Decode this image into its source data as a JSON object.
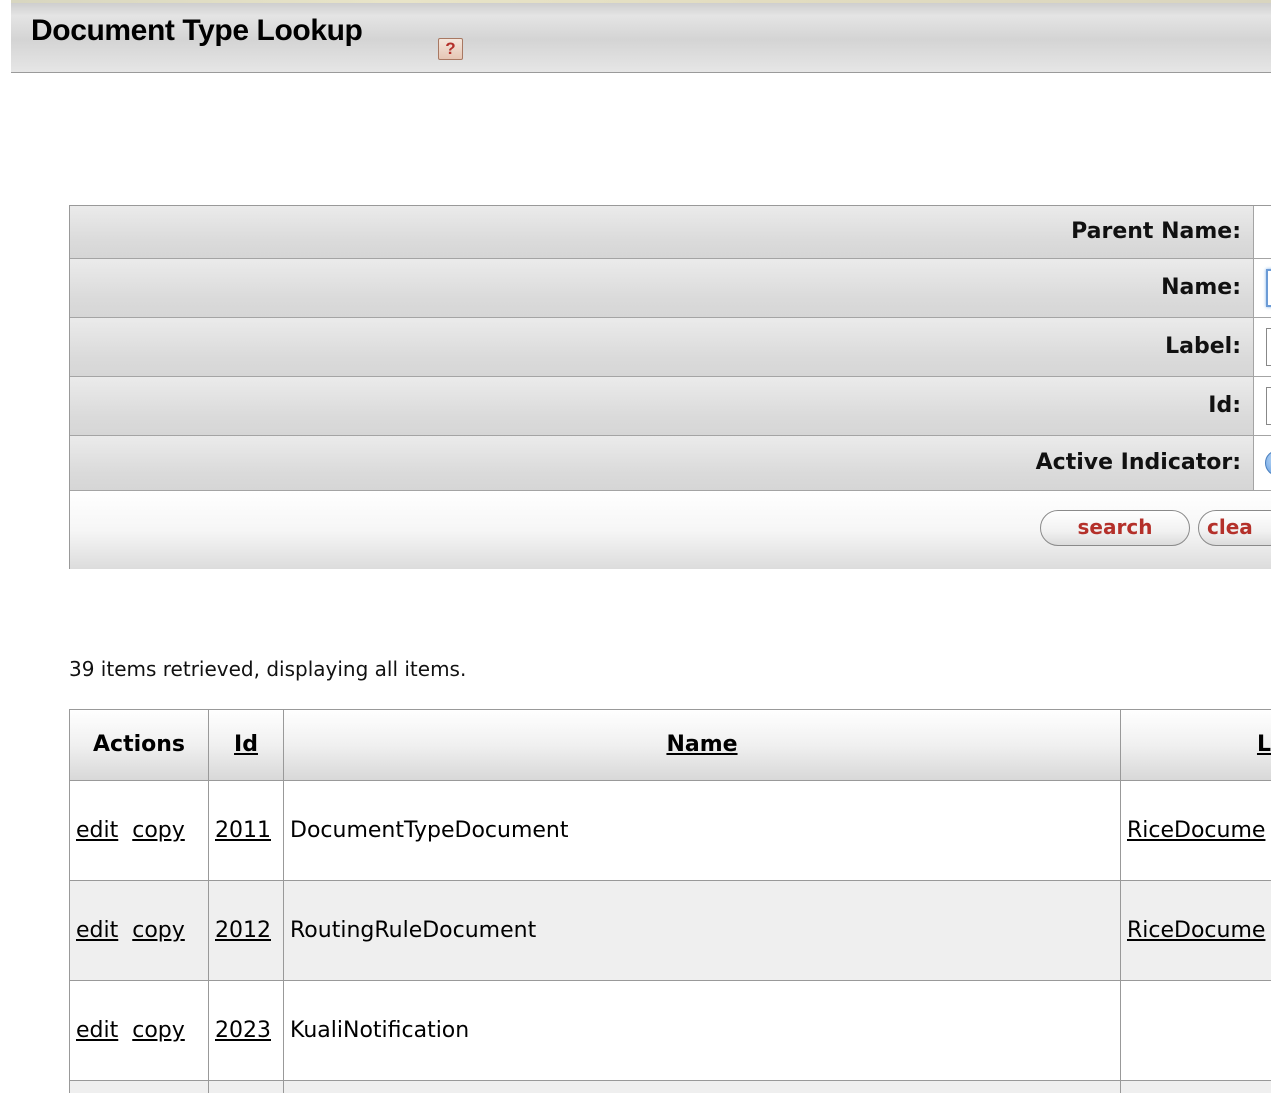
{
  "header": {
    "title": "Document Type Lookup",
    "help_icon": "?"
  },
  "criteria": {
    "fields": [
      {
        "label": "Parent Name:"
      },
      {
        "label": "Name:"
      },
      {
        "label": "Label:"
      },
      {
        "label": "Id:"
      },
      {
        "label": "Active Indicator:"
      }
    ],
    "buttons": {
      "search": "search",
      "clear": "clea"
    }
  },
  "results": {
    "count_text": "39 items retrieved, displaying all items.",
    "columns": [
      "Actions",
      "Id",
      "Name",
      "L"
    ],
    "rows": [
      {
        "edit": "edit",
        "copy": "copy",
        "id": "2011",
        "name": "DocumentTypeDocument",
        "parent": "RiceDocume"
      },
      {
        "edit": "edit",
        "copy": "copy",
        "id": "2012",
        "name": "RoutingRuleDocument",
        "parent": "RiceDocume"
      },
      {
        "edit": "edit",
        "copy": "copy",
        "id": "2023",
        "name": "KualiNotification",
        "parent": ""
      }
    ]
  }
}
